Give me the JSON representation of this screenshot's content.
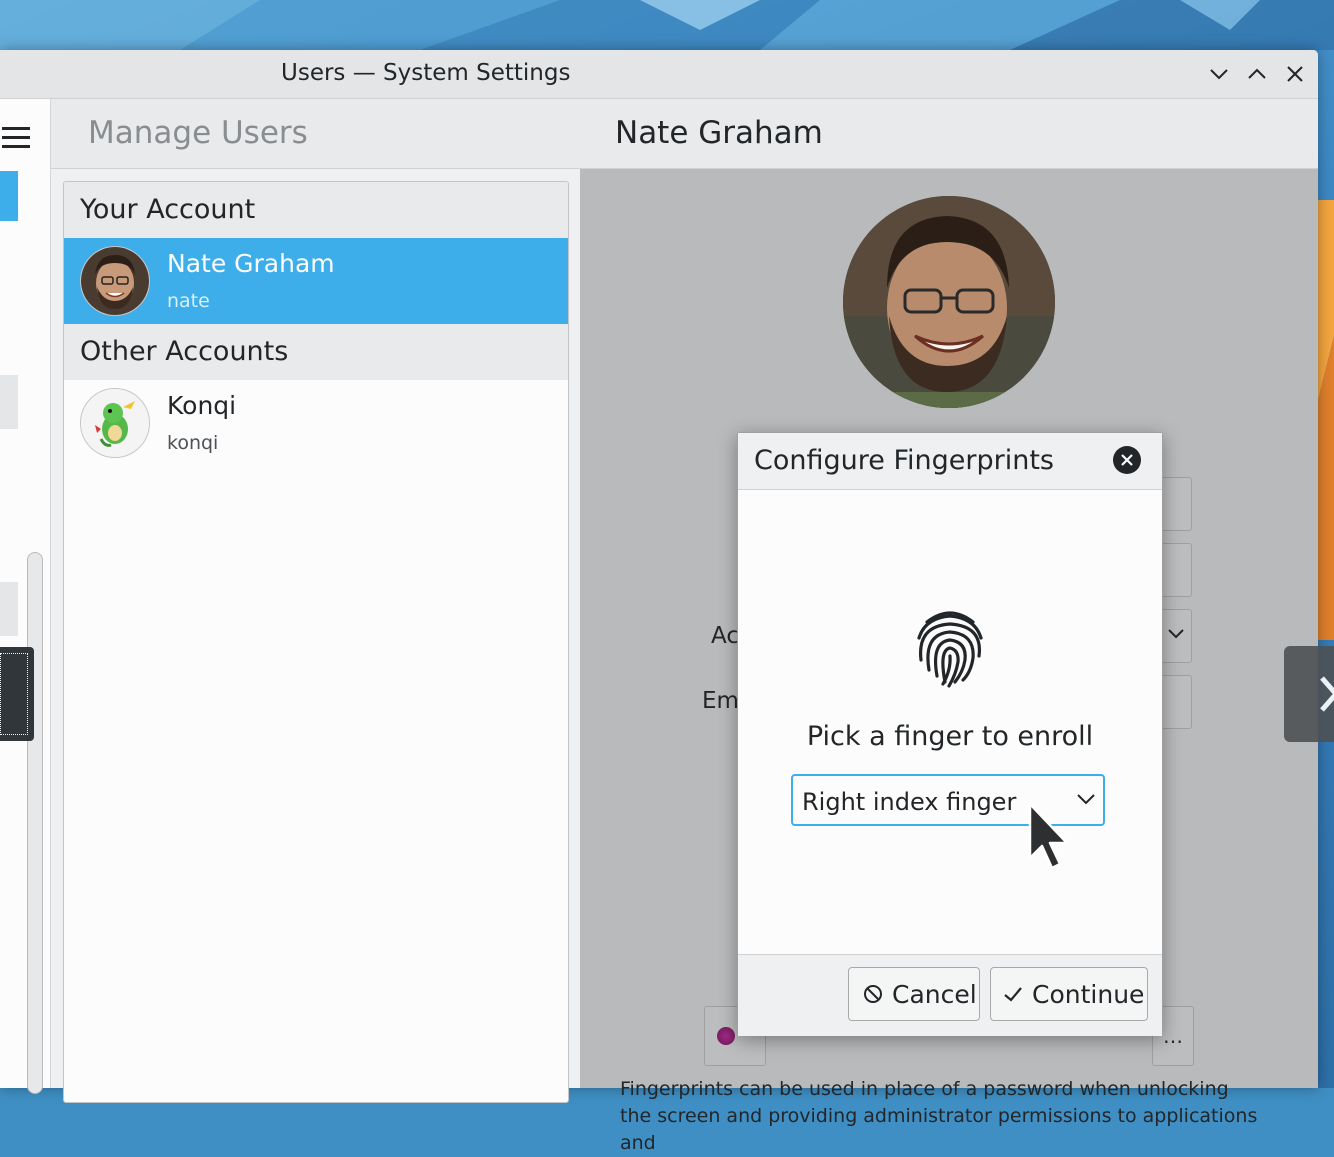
{
  "window": {
    "title": "Users — System Settings"
  },
  "header": {
    "section_title": "Manage Users",
    "user_title": "Nate Graham"
  },
  "user_list": {
    "your_account_heading": "Your Account",
    "other_accounts_heading": "Other Accounts",
    "users": [
      {
        "name": "Nate Graham",
        "login": "nate",
        "selected": true
      },
      {
        "name": "Konqi",
        "login": "konqi",
        "selected": false
      }
    ]
  },
  "detail": {
    "partial_labels": {
      "account_type": "Ac",
      "email": "Em"
    },
    "more_button": "…",
    "fingerprint_description": "Fingerprints can be used in place of a password when unlocking the screen and providing administrator permissions to applications and"
  },
  "dialog": {
    "title": "Configure Fingerprints",
    "prompt": "Pick a finger to enroll",
    "finger_select": {
      "value": "Right index finger"
    },
    "cancel_label": "Cancel",
    "continue_label": "Continue"
  },
  "colors": {
    "accent": "#3daee9",
    "window_bg": "#eff0f1",
    "text": "#232629"
  },
  "icons": [
    "hamburger-menu-icon",
    "minimize-icon",
    "maximize-icon",
    "close-icon",
    "dialog-close-icon",
    "fingerprint-icon",
    "chevron-down-icon",
    "cancel-icon",
    "checkmark-icon",
    "chevron-right-icon",
    "mouse-cursor-icon"
  ]
}
